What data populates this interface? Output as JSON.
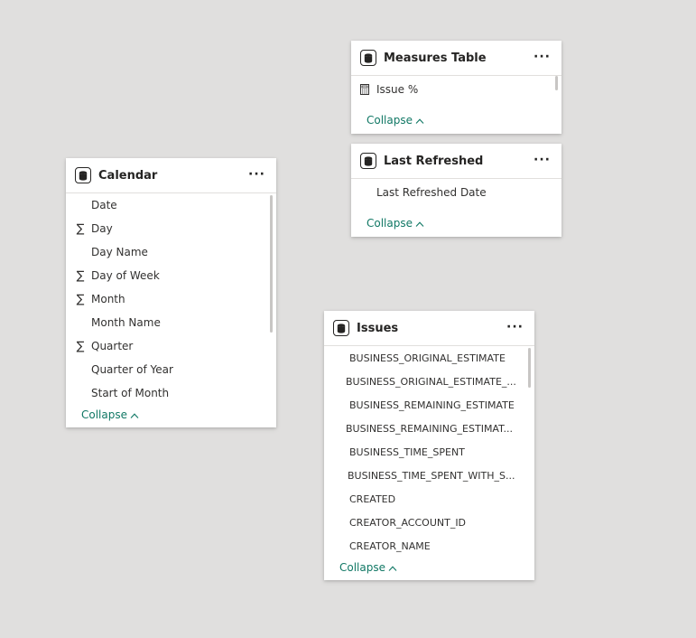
{
  "calendar": {
    "title": "Calendar",
    "more": "···",
    "collapse": "Collapse",
    "fields": [
      {
        "label": "Date",
        "icon": ""
      },
      {
        "label": "Day",
        "icon": "∑"
      },
      {
        "label": "Day Name",
        "icon": ""
      },
      {
        "label": "Day of Week",
        "icon": "∑"
      },
      {
        "label": "Month",
        "icon": "∑"
      },
      {
        "label": "Month Name",
        "icon": ""
      },
      {
        "label": "Quarter",
        "icon": "∑"
      },
      {
        "label": "Quarter of Year",
        "icon": ""
      },
      {
        "label": "Start of Month",
        "icon": ""
      }
    ]
  },
  "measures": {
    "title": "Measures Table",
    "more": "···",
    "collapse": "Collapse",
    "fields": [
      {
        "label": "Issue %",
        "icon": "calculator-icon"
      }
    ]
  },
  "last_refreshed": {
    "title": "Last Refreshed",
    "more": "···",
    "collapse": "Collapse",
    "fields": [
      {
        "label": "Last Refreshed Date",
        "icon": ""
      }
    ]
  },
  "issues": {
    "title": "Issues",
    "more": "···",
    "collapse": "Collapse",
    "fields": [
      {
        "label": "BUSINESS_ORIGINAL_ESTIMATE"
      },
      {
        "label": "BUSINESS_ORIGINAL_ESTIMATE_..."
      },
      {
        "label": "BUSINESS_REMAINING_ESTIMATE"
      },
      {
        "label": "BUSINESS_REMAINING_ESTIMAT..."
      },
      {
        "label": "BUSINESS_TIME_SPENT"
      },
      {
        "label": "BUSINESS_TIME_SPENT_WITH_S..."
      },
      {
        "label": "CREATED"
      },
      {
        "label": "CREATOR_ACCOUNT_ID"
      },
      {
        "label": "CREATOR_NAME"
      }
    ]
  },
  "colors": {
    "canvas": "#e0dfde",
    "card": "#ffffff",
    "collapse_link": "#117865",
    "scrollbar": "#c8c6c4"
  }
}
